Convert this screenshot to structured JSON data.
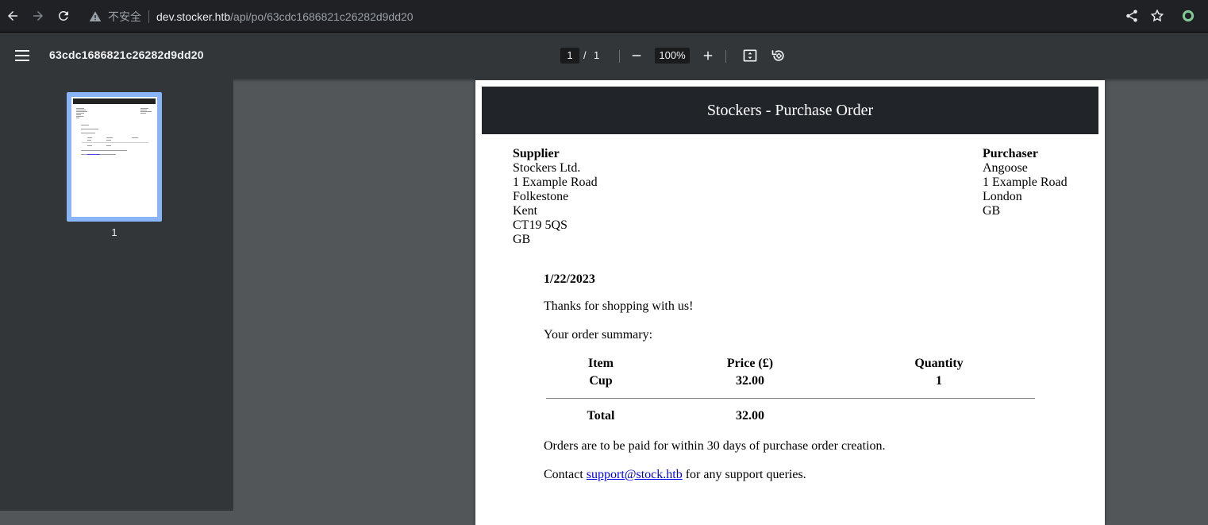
{
  "browser": {
    "security_label": "不安全",
    "url_host": "dev.stocker.htb",
    "url_path": "/api/po/63cdc1686821c26282d9dd20"
  },
  "toolbar": {
    "doc_title": "63cdc1686821c26282d9dd20",
    "current_page": "1",
    "page_separator": "/",
    "total_pages": "1",
    "zoom": "100%"
  },
  "sidebar": {
    "thumbnail_label": "1"
  },
  "po": {
    "title": "Stockers - Purchase Order",
    "supplier": {
      "heading": "Supplier",
      "lines": [
        "Stockers Ltd.",
        "1 Example Road",
        "Folkestone",
        "Kent",
        "CT19 5QS",
        "GB"
      ]
    },
    "purchaser": {
      "heading": "Purchaser",
      "lines": [
        "Angoose",
        "1 Example Road",
        "London",
        "GB"
      ]
    },
    "date": "1/22/2023",
    "thanks": "Thanks for shopping with us!",
    "summary_label": "Your order summary:",
    "table": {
      "headers": [
        "Item",
        "Price (£)",
        "Quantity"
      ],
      "rows": [
        [
          "Cup",
          "32.00",
          "1"
        ]
      ],
      "total_label": "Total",
      "total_value": "32.00"
    },
    "payment_note": "Orders are to be paid for within 30 days of purchase order creation.",
    "contact_prefix": "Contact ",
    "contact_email": "support@stock.htb",
    "contact_suffix": " for any support queries."
  }
}
